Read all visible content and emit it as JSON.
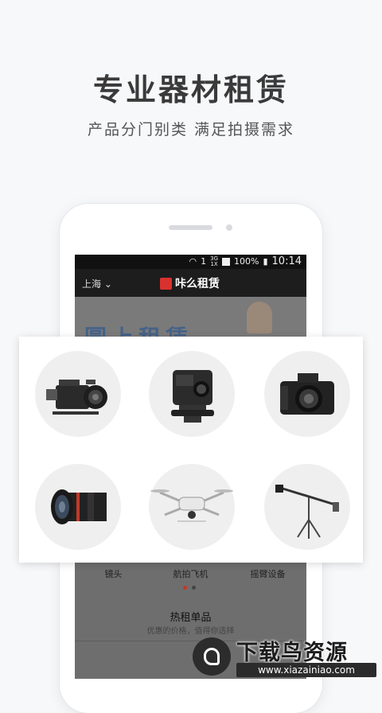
{
  "headline": "专业器材租赁",
  "subline": "产品分门别类 满足拍摄需求",
  "statusbar": {
    "signal_top": "3G",
    "signal_bottom": "1X",
    "sim": "1",
    "battery": "100%",
    "time": "10:14"
  },
  "appbar": {
    "city": "上海",
    "brand": "咔么租赁"
  },
  "banner_text": "圆上租赁",
  "products_row2_labels": [
    "镜头",
    "航拍飞机",
    "摇臂设备"
  ],
  "section": {
    "title": "热租单品",
    "subtitle": "优惠的价格，值得你选择"
  },
  "watermark": {
    "title": "下载鸟资源",
    "url": "www.xiazainiao.com"
  },
  "icons": [
    "cinema-camera-icon",
    "action-camera-icon",
    "dslr-camera-icon",
    "lens-icon",
    "drone-icon",
    "jib-crane-icon"
  ]
}
